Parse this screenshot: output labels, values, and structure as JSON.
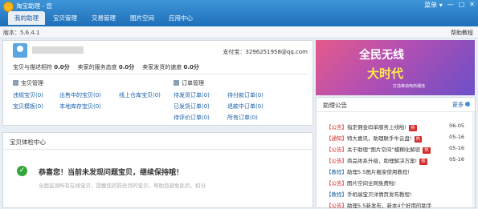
{
  "app": {
    "title": "淘宝助理 - 您",
    "menu": "菜单 ▾"
  },
  "tabs": [
    "我的助理",
    "宝贝管理",
    "交易管理",
    "图片空间",
    "应用中心"
  ],
  "version": "版本：5.6.4.1",
  "help": "帮助教程",
  "user": {
    "alipay": "支付宝：3296251958@qq.com",
    "ratings": [
      {
        "label": "宝贝与描述相符",
        "value": "0.0分"
      },
      {
        "label": "卖家的服务态度",
        "value": "0.0分"
      },
      {
        "label": "卖家发货的速度",
        "value": "0.0分"
      }
    ]
  },
  "item_mgmt": {
    "title": "宝贝管理",
    "links": [
      {
        "label": "违规宝贝",
        "count": "(0)"
      },
      {
        "label": "出售中的宝贝",
        "count": "(0)"
      },
      {
        "label": "线上仓库宝贝",
        "count": "(0)"
      },
      {
        "label": "宝贝模板",
        "count": "(0)"
      },
      {
        "label": "本地库存宝贝",
        "count": "(0)"
      }
    ]
  },
  "order_mgmt": {
    "title": "订单管理",
    "links": [
      {
        "label": "待发货订单",
        "count": "(0)"
      },
      {
        "label": "待付款订单",
        "count": "(0)"
      },
      {
        "label": "已发货订单",
        "count": "(0)"
      },
      {
        "label": "退款中订单",
        "count": "(0)"
      },
      {
        "label": "待评价订单",
        "count": "(0)"
      },
      {
        "label": "所有订单",
        "count": "(0)"
      }
    ]
  },
  "health": {
    "title": "宝贝体检中心",
    "message": "恭喜您！当前未发现问题宝贝，继续保持哦！",
    "sub": "全面监测所有在线宝贝，提醒您药防处罚的宝贝，帮助您避免处罚，扣分"
  },
  "banner": {
    "line1": "全民无线",
    "line2": "大时代",
    "small": "打造移动电商潮流"
  },
  "notice": {
    "title": "助理公告",
    "more": "更多",
    "items": [
      {
        "tag": "【公告】",
        "text": "指定佣金码单服务上线啦!",
        "hot": "热",
        "date": "06-05"
      },
      {
        "tag": "【通知】",
        "text": "特大喜讯，助理联手牛云盘!",
        "hot": "热",
        "date": "05-16"
      },
      {
        "tag": "【公告】",
        "text": "关于助理“图片空间”模糊化解密",
        "hot": "热",
        "date": "05-16"
      },
      {
        "tag": "【公告】",
        "text": "商品体系升级，助理解决方案!",
        "hot": "热",
        "date": "05-16"
      },
      {
        "tag": "【教程】",
        "text": "助理5.5图片搬家使用教程!",
        "hot": "",
        "date": ""
      },
      {
        "tag": "【公告】",
        "text": "图片空间全网免费啦!",
        "hot": "",
        "date": ""
      },
      {
        "tag": "【教程】",
        "text": "手机端宝贝详情页发布教程!",
        "hot": "",
        "date": ""
      },
      {
        "tag": "【公告】",
        "text": "助理5.5新发布，新本4个好用的助手",
        "hot": "",
        "date": ""
      }
    ]
  },
  "colors": {
    "accent": "#1f6fb8",
    "link": "#1a5fa8",
    "tag": "#d62b2b",
    "ok": "#33a63a"
  }
}
